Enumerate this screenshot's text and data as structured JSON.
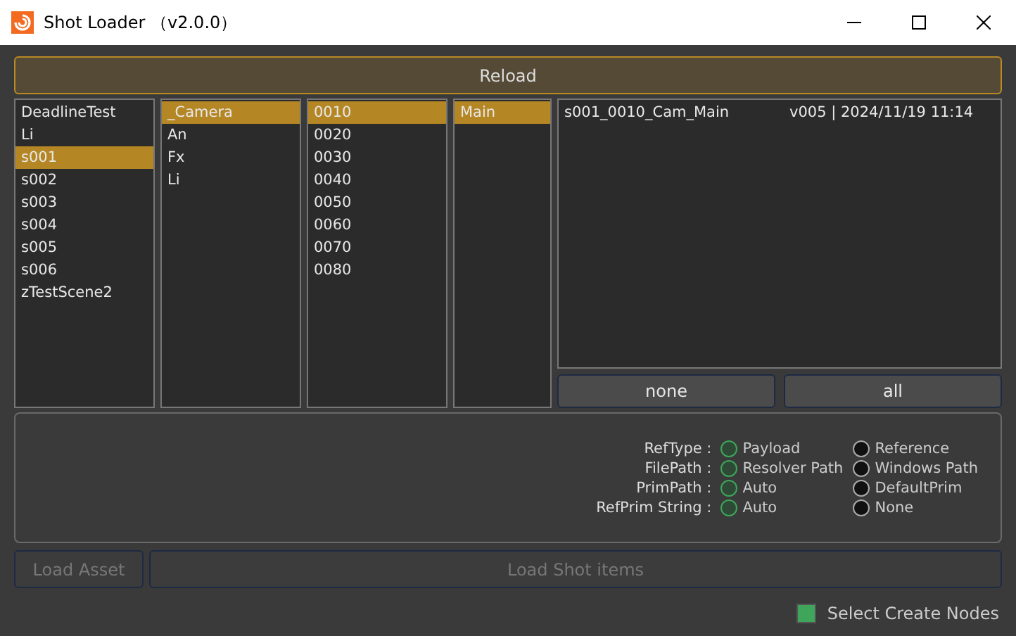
{
  "window": {
    "title": "Shot Loader （v2.0.0）"
  },
  "reload_button": "Reload",
  "lists": [
    {
      "items": [
        {
          "label": "DeadlineTest",
          "selected": false
        },
        {
          "label": "Li",
          "selected": false
        },
        {
          "label": "s001",
          "selected": true
        },
        {
          "label": "s002",
          "selected": false
        },
        {
          "label": "s003",
          "selected": false
        },
        {
          "label": "s004",
          "selected": false
        },
        {
          "label": "s005",
          "selected": false
        },
        {
          "label": "s006",
          "selected": false
        },
        {
          "label": "zTestScene2",
          "selected": false
        }
      ]
    },
    {
      "items": [
        {
          "label": "_Camera",
          "selected": true
        },
        {
          "label": "An",
          "selected": false
        },
        {
          "label": "Fx",
          "selected": false
        },
        {
          "label": "Li",
          "selected": false
        }
      ]
    },
    {
      "items": [
        {
          "label": "0010",
          "selected": true
        },
        {
          "label": "0020",
          "selected": false
        },
        {
          "label": "0030",
          "selected": false
        },
        {
          "label": "0040",
          "selected": false
        },
        {
          "label": "0050",
          "selected": false
        },
        {
          "label": "0060",
          "selected": false
        },
        {
          "label": "0070",
          "selected": false
        },
        {
          "label": "0080",
          "selected": false
        }
      ]
    },
    {
      "items": [
        {
          "label": "Main",
          "selected": true
        }
      ]
    }
  ],
  "results": [
    {
      "name": "s001_0010_Cam_Main",
      "info": "v005 | 2024/11/19 11:14"
    }
  ],
  "select_buttons": [
    "none",
    "all"
  ],
  "options": [
    {
      "label": "RefType :",
      "choices": [
        {
          "label": "Payload",
          "selected": true
        },
        {
          "label": "Reference",
          "selected": false
        }
      ]
    },
    {
      "label": "FilePath :",
      "choices": [
        {
          "label": "Resolver Path",
          "selected": true
        },
        {
          "label": "Windows Path",
          "selected": false
        }
      ]
    },
    {
      "label": "PrimPath :",
      "choices": [
        {
          "label": "Auto",
          "selected": true
        },
        {
          "label": "DefaultPrim",
          "selected": false
        }
      ]
    },
    {
      "label": "RefPrim String :",
      "choices": [
        {
          "label": "Auto",
          "selected": true
        },
        {
          "label": "None",
          "selected": false
        }
      ]
    }
  ],
  "load_buttons": [
    {
      "label": "Load Asset",
      "disabled": true
    },
    {
      "label": "Load Shot items",
      "disabled": true
    }
  ],
  "select_create_nodes": {
    "label": "Select Create Nodes",
    "checked": true
  }
}
